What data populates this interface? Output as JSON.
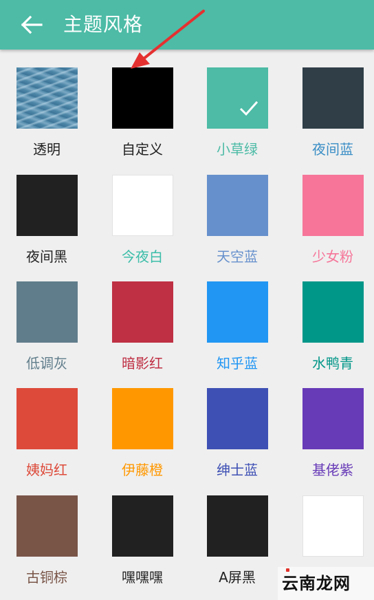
{
  "header": {
    "title": "主题风格",
    "back_icon": "arrow-left-icon",
    "background": "#4dbba6"
  },
  "themes": [
    {
      "label": "透明",
      "color": "#4c86a7",
      "label_color": "#222222",
      "texture": "water"
    },
    {
      "label": "自定义",
      "color": "#000000",
      "label_color": "#222222"
    },
    {
      "label": "小草绿",
      "color": "#4dbba6",
      "label_color": "#4dbba6",
      "selected": true
    },
    {
      "label": "夜间蓝",
      "color": "#2f3e47",
      "label_color": "#3a8ec6"
    },
    {
      "label": "夜间黑",
      "color": "#212121",
      "label_color": "#222222"
    },
    {
      "label": "今夜白",
      "color": "#ffffff",
      "label_color": "#3bbda8"
    },
    {
      "label": "天空蓝",
      "color": "#6690cc",
      "label_color": "#6690cc"
    },
    {
      "label": "少女粉",
      "color": "#f67599",
      "label_color": "#f67599"
    },
    {
      "label": "低调灰",
      "color": "#607d8b",
      "label_color": "#607d8b"
    },
    {
      "label": "暗影红",
      "color": "#bf3044",
      "label_color": "#bf3044"
    },
    {
      "label": "知乎蓝",
      "color": "#2196f3",
      "label_color": "#2196f3"
    },
    {
      "label": "水鸭青",
      "color": "#009688",
      "label_color": "#009688"
    },
    {
      "label": "姨妈红",
      "color": "#dd4a3a",
      "label_color": "#dd4a3a"
    },
    {
      "label": "伊藤橙",
      "color": "#ff9800",
      "label_color": "#ff9800"
    },
    {
      "label": "绅士蓝",
      "color": "#3e50b4",
      "label_color": "#3e50b4"
    },
    {
      "label": "基佬紫",
      "color": "#673ab7",
      "label_color": "#673ab7"
    },
    {
      "label": "古铜棕",
      "color": "#795548",
      "label_color": "#795548"
    },
    {
      "label": "嘿嘿嘿",
      "color": "#212121",
      "label_color": "#222222"
    },
    {
      "label": "A屏黑",
      "color": "#212121",
      "label_color": "#222222"
    },
    {
      "label": "",
      "color": "#ffffff",
      "label_color": "#2196f3"
    }
  ],
  "selected_check_icon": "checkmark-icon",
  "annotation": {
    "icon": "red-arrow-icon",
    "color": "#e53030"
  },
  "watermark": {
    "text": "云南龙网",
    "icon": "site-logo-icon"
  }
}
